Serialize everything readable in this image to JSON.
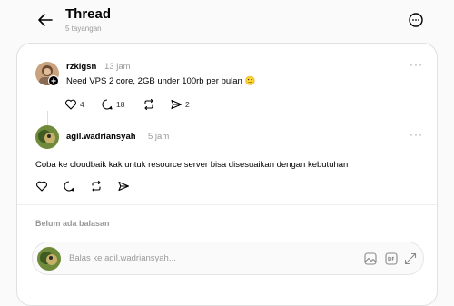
{
  "header": {
    "title": "Thread",
    "subtitle": "5 tayangan",
    "back_icon": "arrow-left-icon",
    "more_icon": "more-circle-icon"
  },
  "posts": [
    {
      "username": "rzkigsn",
      "time": "13 jam",
      "text": "Need VPS 2 core, 2GB under 100rb per bulan 🙂",
      "more": "···",
      "likes": "4",
      "comments": "18",
      "reposts": "",
      "shares": "2"
    },
    {
      "username": "agil.wadriansyah",
      "time": "5 jam",
      "text": "Coba ke cloudbaik kak untuk resource server bisa disesuaikan dengan kebutuhan",
      "more": "···",
      "likes": "",
      "comments": "",
      "reposts": "",
      "shares": ""
    }
  ],
  "replies_section": {
    "empty_label": "Belum ada balasan"
  },
  "reply_box": {
    "placeholder": "Balas ke agil.wadriansyah...",
    "tools": [
      "image-icon",
      "gif-icon",
      "expand-icon"
    ]
  },
  "colors": {
    "background": "#fafafa",
    "card": "#ffffff",
    "muted_text": "#999999",
    "border": "#e0e0e0"
  }
}
